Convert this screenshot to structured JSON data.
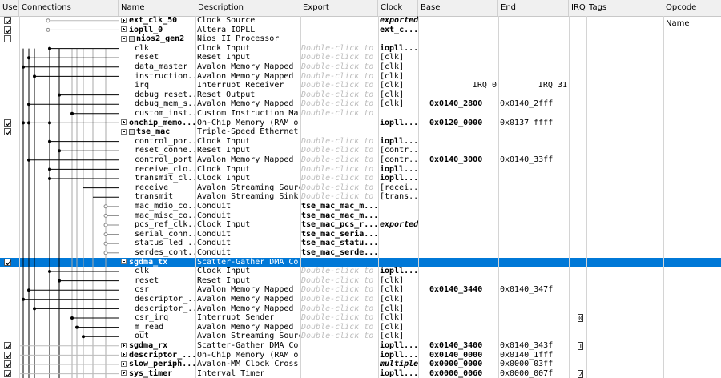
{
  "headers": {
    "use": "Use",
    "connections": "Connections",
    "name": "Name",
    "description": "Description",
    "export": "Export",
    "clock": "Clock",
    "base": "Base",
    "end": "End",
    "irq": "IRQ",
    "tags": "Tags",
    "opcode": "Opcode Name"
  },
  "rows": [
    {
      "check": true,
      "expander": "plus",
      "name": "ext_clk_50",
      "name_bold": true,
      "desc": "Clock Source",
      "export": "",
      "clock": "exported",
      "clock_style": "bi",
      "base": "",
      "end": ""
    },
    {
      "check": true,
      "expander": "plus",
      "name": "iopll_0",
      "name_bold": true,
      "desc": "Altera IOPLL",
      "export": "",
      "clock": "ext_c...",
      "clock_style": "b",
      "base": "",
      "end": ""
    },
    {
      "check": false,
      "expander": "minus",
      "name": "nios2_gen2",
      "name_bold": true,
      "icon": "lock",
      "desc": "Nios II Processor",
      "export": "",
      "clock": "",
      "base": "",
      "end": ""
    },
    {
      "check": false,
      "indent": true,
      "name": "clk",
      "desc": "Clock Input",
      "export": "Double-click to",
      "clock": "iopll...",
      "clock_style": "b",
      "base": "",
      "end": ""
    },
    {
      "check": false,
      "indent": true,
      "name": "reset",
      "desc": "Reset Input",
      "export": "Double-click to",
      "clock": "[clk]",
      "base": "",
      "end": ""
    },
    {
      "check": false,
      "indent": true,
      "name": "data_master",
      "desc": "Avalon Memory Mapped ...",
      "export": "Double-click to",
      "clock": "[clk]",
      "base": "",
      "end": ""
    },
    {
      "check": false,
      "indent": true,
      "name": "instruction...",
      "desc": "Avalon Memory Mapped ...",
      "export": "Double-click to",
      "clock": "[clk]",
      "base": "",
      "end": ""
    },
    {
      "check": false,
      "indent": true,
      "name": "irq",
      "desc": "Interrupt Receiver",
      "export": "Double-click to",
      "clock": "[clk]",
      "base": "IRQ 0",
      "base_right": true,
      "end": "IRQ 31",
      "end_right": true
    },
    {
      "check": false,
      "indent": true,
      "name": "debug_reset...",
      "desc": "Reset Output",
      "export": "Double-click to",
      "clock": "[clk]",
      "base": "",
      "end": ""
    },
    {
      "check": false,
      "indent": true,
      "name": "debug_mem_s...",
      "desc": "Avalon Memory Mapped ...",
      "export": "Double-click to",
      "clock": "[clk]",
      "base": "0x0140_2800",
      "base_bold": true,
      "end": "0x0140_2fff"
    },
    {
      "check": false,
      "indent": true,
      "name": "custom_inst...",
      "desc": "Custom Instruction Ma...",
      "export": "Double-click to",
      "clock": "",
      "base": "",
      "end": ""
    },
    {
      "check": true,
      "expander": "plus",
      "name": "onchip_memo...",
      "name_bold": true,
      "desc": "On-Chip Memory (RAM o...",
      "export": "",
      "clock": "iopll...",
      "clock_style": "b",
      "base": "0x0120_0000",
      "base_bold": true,
      "end": "0x0137_ffff"
    },
    {
      "check": true,
      "expander": "minus",
      "name": "tse_mac",
      "name_bold": true,
      "icon": "lock",
      "desc": "Triple-Speed Ethernet",
      "export": "",
      "clock": "",
      "base": "",
      "end": ""
    },
    {
      "check": false,
      "indent": true,
      "name": "control_por...",
      "desc": "Clock Input",
      "export": "Double-click to",
      "clock": "iopll...",
      "clock_style": "b",
      "base": "",
      "end": ""
    },
    {
      "check": false,
      "indent": true,
      "name": "reset_conne...",
      "desc": "Reset Input",
      "export": "Double-click to",
      "clock": "[contr...",
      "base": "",
      "end": ""
    },
    {
      "check": false,
      "indent": true,
      "name": "control_port",
      "desc": "Avalon Memory Mapped ...",
      "export": "Double-click to",
      "clock": "[contr...",
      "base": "0x0140_3000",
      "base_bold": true,
      "end": "0x0140_33ff"
    },
    {
      "check": false,
      "indent": true,
      "name": "receive_clo...",
      "desc": "Clock Input",
      "export": "Double-click to",
      "clock": "iopll...",
      "clock_style": "b",
      "base": "",
      "end": ""
    },
    {
      "check": false,
      "indent": true,
      "name": "transmit_cl...",
      "desc": "Clock Input",
      "export": "Double-click to",
      "clock": "iopll...",
      "clock_style": "b",
      "base": "",
      "end": ""
    },
    {
      "check": false,
      "indent": true,
      "name": "receive",
      "desc": "Avalon Streaming Source",
      "export": "Double-click to",
      "clock": "[recei...",
      "base": "",
      "end": ""
    },
    {
      "check": false,
      "indent": true,
      "name": "transmit",
      "desc": "Avalon Streaming Sink",
      "export": "Double-click to",
      "clock": "[trans...",
      "base": "",
      "end": ""
    },
    {
      "check": false,
      "indent": true,
      "name": "mac_mdio_co...",
      "desc": "Conduit",
      "export": "tse_mac_mac_m...",
      "export_bold": true,
      "clock": "",
      "base": "",
      "end": ""
    },
    {
      "check": false,
      "indent": true,
      "name": "mac_misc_co...",
      "desc": "Conduit",
      "export": "tse_mac_mac_m...",
      "export_bold": true,
      "clock": "",
      "base": "",
      "end": ""
    },
    {
      "check": false,
      "indent": true,
      "name": "pcs_ref_clk...",
      "desc": "Clock Input",
      "export": "tse_mac_pcs_r...",
      "export_bold": true,
      "clock": "exported",
      "clock_style": "bi",
      "base": "",
      "end": ""
    },
    {
      "check": false,
      "indent": true,
      "name": "serial_conn...",
      "desc": "Conduit",
      "export": "tse_mac_seria...",
      "export_bold": true,
      "clock": "",
      "base": "",
      "end": ""
    },
    {
      "check": false,
      "indent": true,
      "name": "status_led_...",
      "desc": "Conduit",
      "export": "tse_mac_statu...",
      "export_bold": true,
      "clock": "",
      "base": "",
      "end": ""
    },
    {
      "check": false,
      "indent": true,
      "name": "serdes_cont...",
      "desc": "Conduit",
      "export": "tse_mac_serde...",
      "export_bold": true,
      "clock": "",
      "base": "",
      "end": ""
    },
    {
      "check": true,
      "expander": "minus",
      "name": "sgdma_tx",
      "name_bold": true,
      "selected": true,
      "desc": "Scatter-Gather DMA Co...",
      "export": "",
      "clock": "",
      "base": "",
      "end": ""
    },
    {
      "check": false,
      "indent": true,
      "name": "clk",
      "desc": "Clock Input",
      "export": "Double-click to",
      "clock": "iopll...",
      "clock_style": "b",
      "base": "",
      "end": ""
    },
    {
      "check": false,
      "indent": true,
      "name": "reset",
      "desc": "Reset Input",
      "export": "Double-click to",
      "clock": "[clk]",
      "base": "",
      "end": ""
    },
    {
      "check": false,
      "indent": true,
      "name": "csr",
      "desc": "Avalon Memory Mapped ...",
      "export": "Double-click to",
      "clock": "[clk]",
      "base": "0x0140_3440",
      "base_bold": true,
      "end": "0x0140_347f"
    },
    {
      "check": false,
      "indent": true,
      "name": "descriptor_...",
      "desc": "Avalon Memory Mapped ...",
      "export": "Double-click to",
      "clock": "[clk]",
      "base": "",
      "end": ""
    },
    {
      "check": false,
      "indent": true,
      "name": "descriptor_...",
      "desc": "Avalon Memory Mapped ...",
      "export": "Double-click to",
      "clock": "[clk]",
      "base": "",
      "end": ""
    },
    {
      "check": false,
      "indent": true,
      "name": "csr_irq",
      "desc": "Interrupt Sender",
      "export": "Double-click to",
      "clock": "[clk]",
      "base": "",
      "end": "",
      "irq_box": "0"
    },
    {
      "check": false,
      "indent": true,
      "name": "m_read",
      "desc": "Avalon Memory Mapped ...",
      "export": "Double-click to",
      "clock": "[clk]",
      "base": "",
      "end": ""
    },
    {
      "check": false,
      "indent": true,
      "name": "out",
      "desc": "Avalon Streaming Source",
      "export": "Double-click to",
      "clock": "[clk]",
      "base": "",
      "end": ""
    },
    {
      "check": true,
      "expander": "plus",
      "name": "sgdma_rx",
      "name_bold": true,
      "desc": "Scatter-Gather DMA Co...",
      "export": "",
      "clock": "iopll...",
      "clock_style": "b",
      "base": "0x0140_3400",
      "base_bold": true,
      "end": "0x0140_343f",
      "irq_box": "1"
    },
    {
      "check": true,
      "expander": "plus",
      "name": "descriptor_...",
      "name_bold": true,
      "desc": "On-Chip Memory (RAM o...",
      "export": "",
      "clock": "iopll...",
      "clock_style": "b",
      "base": "0x0140_0000",
      "base_bold": true,
      "end": "0x0140_1fff"
    },
    {
      "check": true,
      "expander": "plus",
      "name": "slow_periph...",
      "name_bold": true,
      "desc": "Avalon-MM Clock Cross...",
      "export": "",
      "clock": "multiple",
      "clock_style": "bi",
      "base": "0x0000_0000",
      "base_bold": true,
      "end": "0x0000_03ff"
    },
    {
      "check": true,
      "expander": "plus",
      "name": "sys_timer",
      "name_bold": true,
      "desc": "Interval Timer",
      "export": "",
      "clock": "iopll...",
      "clock_style": "b",
      "base": "0x0000_0060",
      "base_bold": true,
      "end": "0x0000_007f",
      "irq_box": "2"
    }
  ]
}
